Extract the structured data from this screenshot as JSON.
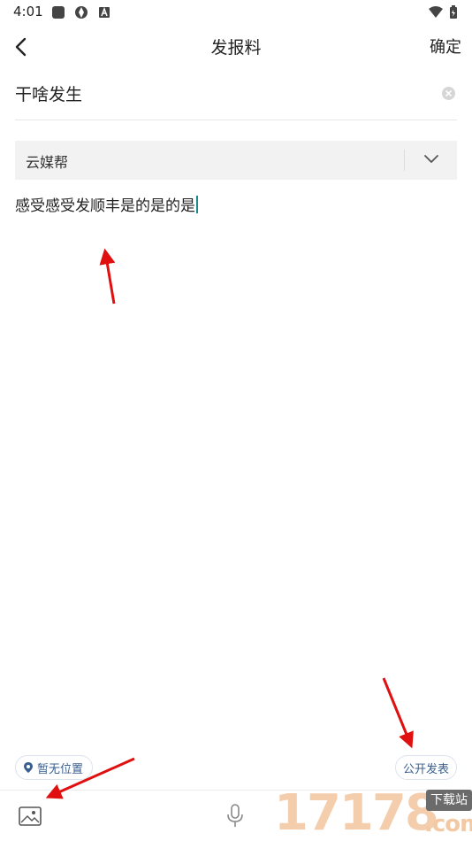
{
  "status_bar": {
    "time": "4:01"
  },
  "header": {
    "title": "发报料",
    "confirm_label": "确定"
  },
  "form": {
    "title_value": "干啥发生",
    "category_value": "云媒帮",
    "content_value": "感受感受发顺丰是的是的是"
  },
  "footer": {
    "location_label": "暂无位置",
    "publish_label": "公开发表"
  },
  "watermark": {
    "digits": "17178",
    "badge": "下载站",
    "domain": ".com"
  },
  "colors": {
    "accent": "#3a5f8f",
    "caret": "#1a8a8a",
    "annotation_arrow": "#e01010"
  },
  "icons": [
    "back-arrow-icon",
    "clear-icon",
    "chevron-down-icon",
    "location-pin-icon",
    "image-icon",
    "microphone-icon"
  ]
}
